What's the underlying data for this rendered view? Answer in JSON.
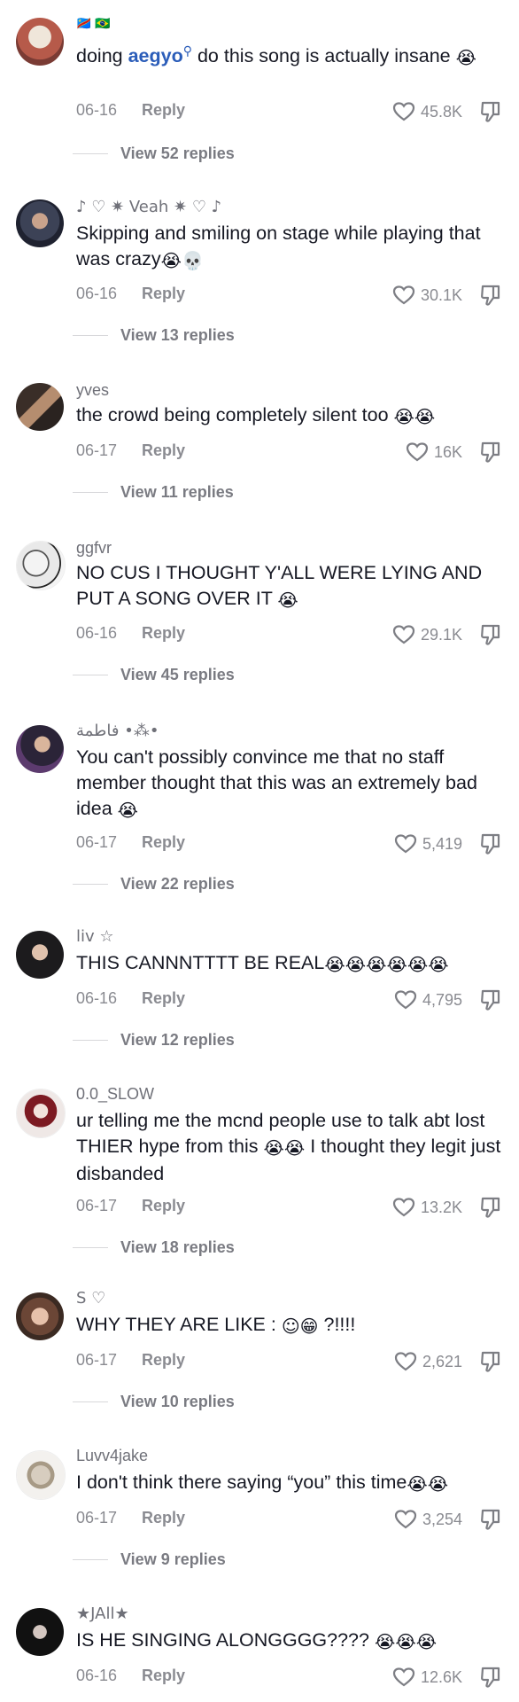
{
  "comments": [
    {
      "username": "",
      "flags": [
        "🇨🇩",
        "🇧🇷"
      ],
      "text_prefix": "doing ",
      "mention": "aegyo",
      "text_suffix": " do this song is actually insane ",
      "emojis": "😭",
      "date": "06-16",
      "reply": "Reply",
      "likes": "45.8K",
      "view_replies": "View 52 replies"
    },
    {
      "username": "♪ ♡ ✷ Veah ✷ ♡ ♪",
      "text": "Skipping and smiling on stage while playing that was crazy",
      "emojis": "😭💀",
      "date": "06-16",
      "reply": "Reply",
      "likes": "30.1K",
      "view_replies": "View 13 replies"
    },
    {
      "username": "yves",
      "text": "the crowd being completely silent too ",
      "emojis": "😭😭",
      "date": "06-17",
      "reply": "Reply",
      "likes": "16K",
      "view_replies": "View 11 replies"
    },
    {
      "username": "ggfvr",
      "text": "NO CUS I THOUGHT Y'ALL WERE LYING AND PUT A SONG OVER IT ",
      "emojis": "😭",
      "date": "06-16",
      "reply": "Reply",
      "likes": "29.1K",
      "view_replies": "View 45 replies"
    },
    {
      "username": "فاطمة •⁂•",
      "text": "You can't possibly convince me that no staff member thought that this was an extremely bad idea ",
      "emojis": "😭",
      "date": "06-17",
      "reply": "Reply",
      "likes": "5,419",
      "view_replies": "View 22 replies"
    },
    {
      "username": "liv ☆",
      "text": "THIS CANNNTTTT BE REAL",
      "emojis": "😭😭😭😭😭😭",
      "date": "06-16",
      "reply": "Reply",
      "likes": "4,795",
      "view_replies": "View 12 replies"
    },
    {
      "username": "0.0_SLOW",
      "text_prefix": "ur telling me the mcnd people use to talk abt lost THIER hype from this ",
      "emojis": "😭😭",
      "text_suffix": " I thought they legit just disbanded",
      "date": "06-17",
      "reply": "Reply",
      "likes": "13.2K",
      "view_replies": "View 18 replies"
    },
    {
      "username": "S ♡",
      "text": "WHY THEY ARE LIKE : ",
      "emojis": "☺😁",
      "text_suffix": " ?!!!!",
      "date": "06-17",
      "reply": "Reply",
      "likes": "2,621",
      "view_replies": "View 10 replies"
    },
    {
      "username": "Luvv4jake",
      "text": "I don't think there saying “you” this time",
      "emojis": "😭😭",
      "date": "06-17",
      "reply": "Reply",
      "likes": "3,254",
      "view_replies": "View 9 replies"
    },
    {
      "username": "★JAll★",
      "text": "IS HE SINGING ALONGGGG???? ",
      "emojis": "😭😭😭",
      "date": "06-16",
      "reply": "Reply",
      "likes": "12.6K"
    }
  ],
  "icons": {
    "like": "heart-outline-icon",
    "dislike": "thumbs-down-icon",
    "mention_badge": "search-icon"
  },
  "colors": {
    "mention": "#2b5db9",
    "meta_text": "#8a8b91",
    "body_text": "#161823"
  }
}
